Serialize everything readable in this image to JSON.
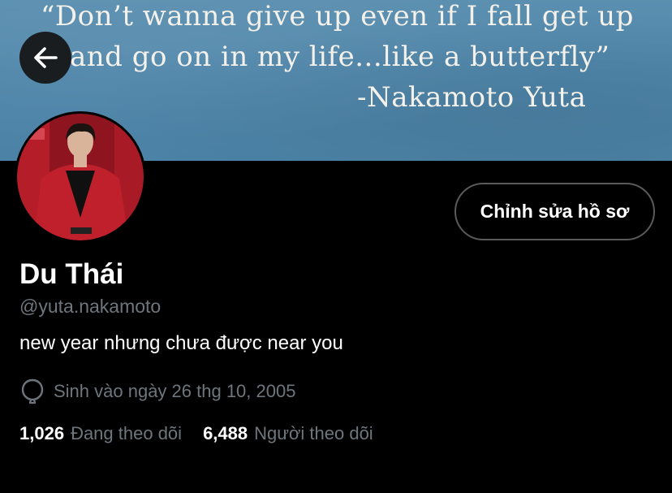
{
  "banner": {
    "quote_line1": "“Don’t wanna give up even if I fall get up",
    "quote_line2": "and go on in my life...like a butterfly”",
    "quote_author": "-Nakamoto Yuta",
    "background_color": "#4f86aa"
  },
  "nav": {
    "back_icon": "arrow-left-icon"
  },
  "profile": {
    "display_name": "Du Thái",
    "handle": "@yuta.nakamoto",
    "bio": "new year nhưng chưa được near you",
    "birth_icon": "balloon-icon",
    "birth_text": "Sinh vào ngày 26 thg 10, 2005",
    "edit_button_label": "Chỉnh sửa hồ sơ"
  },
  "stats": {
    "following_count": "1,026",
    "following_label": "Đang theo dõi",
    "followers_count": "6,488",
    "followers_label": "Người theo dõi"
  },
  "colors": {
    "background": "#000000",
    "muted_text": "#6e767d",
    "button_border": "#5a5a5a",
    "primary_text": "#ffffff"
  }
}
